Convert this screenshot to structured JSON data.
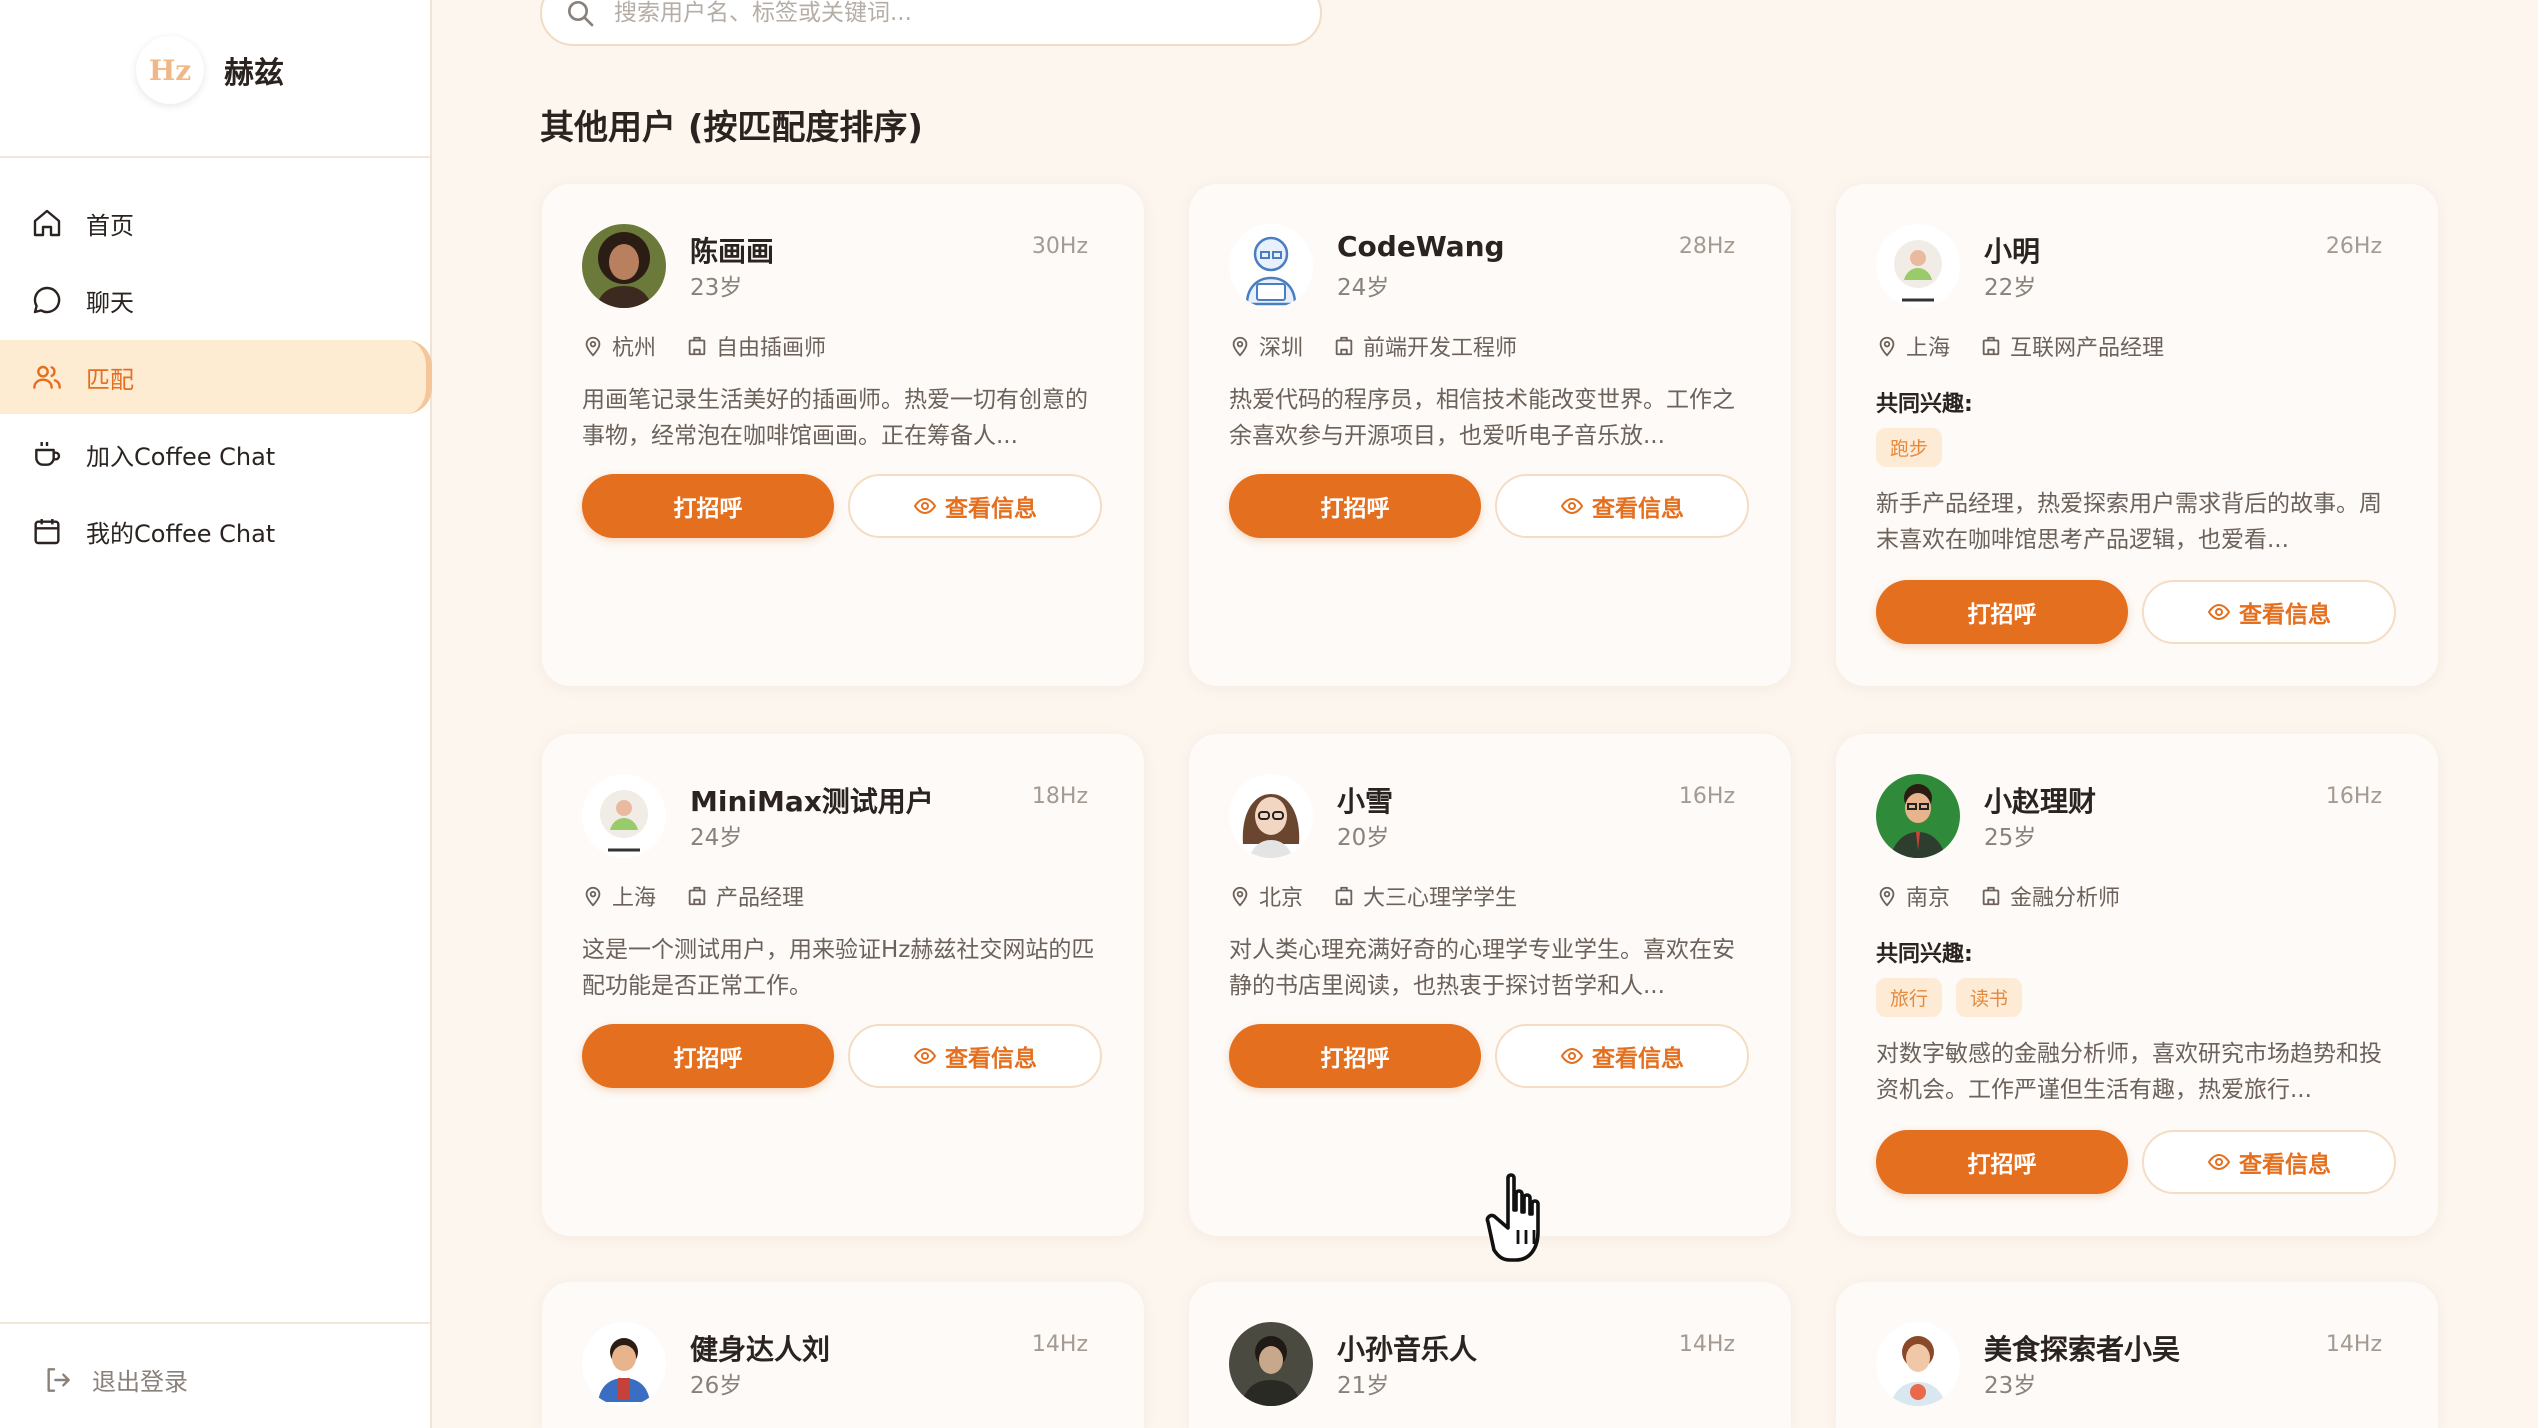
{
  "brand": {
    "logo_text": "Hz",
    "name": "赫兹"
  },
  "nav": {
    "items": [
      {
        "label": "首页",
        "icon": "home-icon"
      },
      {
        "label": "聊天",
        "icon": "chat-bubble-icon"
      },
      {
        "label": "匹配",
        "icon": "users-icon",
        "active": true
      },
      {
        "label": "加入Coffee Chat",
        "icon": "coffee-cup-icon"
      },
      {
        "label": "我的Coffee Chat",
        "icon": "calendar-icon"
      }
    ],
    "logout": "退出登录"
  },
  "search": {
    "placeholder": "搜索用户名、标签或关键词..."
  },
  "section_title": "其他用户 (按匹配度排序)",
  "buttons": {
    "greet": "打招呼",
    "view": "查看信息"
  },
  "common_interests_label": "共同兴趣:",
  "users": [
    {
      "name": "陈画画",
      "age": "23岁",
      "hz": "30Hz",
      "city": "杭州",
      "job": "自由插画师",
      "tags": [],
      "bio": "用画笔记录生活美好的插画师。热爱一切有创意的事物，经常泡在咖啡馆画画。正在筹备人..."
    },
    {
      "name": "CodeWang",
      "age": "24岁",
      "hz": "28Hz",
      "city": "深圳",
      "job": "前端开发工程师",
      "tags": [],
      "bio": "热爱代码的程序员，相信技术能改变世界。工作之余喜欢参与开源项目，也爱听电子音乐放..."
    },
    {
      "name": "小明",
      "age": "22岁",
      "hz": "26Hz",
      "city": "上海",
      "job": "互联网产品经理",
      "tags": [
        "跑步"
      ],
      "bio": "新手产品经理，热爱探索用户需求背后的故事。周末喜欢在咖啡馆思考产品逻辑，也爱看..."
    },
    {
      "name": "MiniMax测试用户",
      "age": "24岁",
      "hz": "18Hz",
      "city": "上海",
      "job": "产品经理",
      "tags": [],
      "bio": "这是一个测试用户，用来验证Hz赫兹社交网站的匹配功能是否正常工作。"
    },
    {
      "name": "小雪",
      "age": "20岁",
      "hz": "16Hz",
      "city": "北京",
      "job": "大三心理学学生",
      "tags": [],
      "bio": "对人类心理充满好奇的心理学专业学生。喜欢在安静的书店里阅读，也热衷于探讨哲学和人..."
    },
    {
      "name": "小赵理财",
      "age": "25岁",
      "hz": "16Hz",
      "city": "南京",
      "job": "金融分析师",
      "tags": [
        "旅行",
        "读书"
      ],
      "bio": "对数字敏感的金融分析师，喜欢研究市场趋势和投资机会。工作严谨但生活有趣，热爱旅行..."
    },
    {
      "name": "健身达人刘",
      "age": "26岁",
      "hz": "14Hz"
    },
    {
      "name": "小孙音乐人",
      "age": "21岁",
      "hz": "14Hz"
    },
    {
      "name": "美食探索者小吴",
      "age": "23岁",
      "hz": "14Hz"
    }
  ],
  "colors": {
    "accent": "#e36f1f",
    "tag_bg": "#fdebd6",
    "background": "#fcf6ef"
  }
}
